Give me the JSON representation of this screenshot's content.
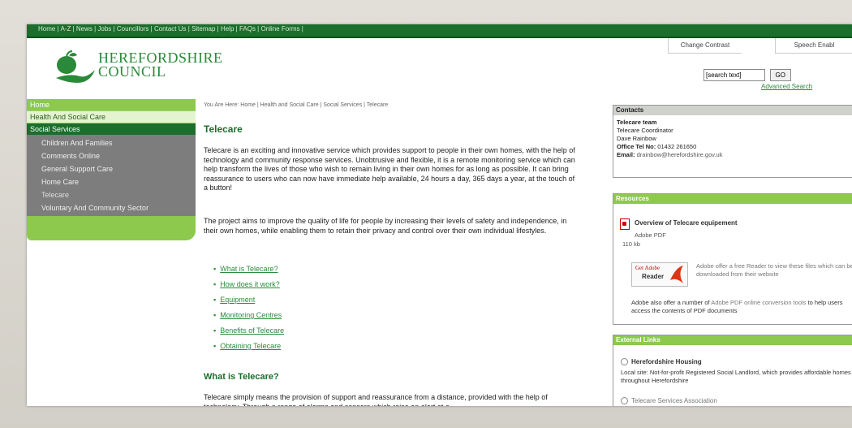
{
  "top_links": [
    "Home",
    "A-Z",
    "News",
    "Jobs",
    "Councillors",
    "Contact Us",
    "Sitemap",
    "Help",
    "FAQs",
    "Online Forms"
  ],
  "utility": {
    "contrast": "Change Contrast",
    "speech": "Speech Enabl"
  },
  "logo": {
    "line1": "HEREFORDSHIRE",
    "line2": "COUNCIL"
  },
  "search": {
    "placeholder": "[search text]",
    "go": "GO",
    "advanced": "Advanced Search"
  },
  "nav": {
    "home": "Home",
    "health": "Health And Social Care",
    "social": "Social Services",
    "items": [
      "Children And Families",
      "Comments Online",
      "General Support Care",
      "Home Care",
      "Telecare",
      "Voluntary And Community Sector"
    ]
  },
  "breadcrumb": "You Are Here: Home | Health and Social Care | Social Services | Telecare",
  "main": {
    "title": "Telecare",
    "para1": "Telecare is an exciting and innovative service which provides support to people in their own homes, with the help of technology and community response services. Unobtrusive and flexible, it is a remote monitoring service which can help transform the lives of those who wish to remain living in their own homes for as long as possible. It can bring reassurance to users who can now have immediate help available, 24 hours a day, 365 days a year, at the touch of a button!",
    "para2": "The project aims to improve the quality of life for people by increasing their levels of safety and independence, in their own homes, while enabling them to retain their privacy and control over their own individual lifestyles.",
    "toc": [
      "What is Telecare?",
      "How does it work?",
      "Equipment",
      "Monitoring Centres",
      "Benefits of Telecare",
      "Obtaining Telecare"
    ],
    "subtitle": "What is Telecare?",
    "para3": "Telecare simply means the provision of support and reassurance from a distance, provided with the help of technology. Through a range of alarms and sensors which raise an alert at a"
  },
  "contacts": {
    "header": "Contacts",
    "team": "Telecare team",
    "role": "Telecare Coordinator",
    "name": "Dave Rainbow",
    "tel_label": "Office Tel No:",
    "tel": "01432 261650",
    "email_label": "Email:",
    "email": "drainbow@herefordshire.gov.uk"
  },
  "resources": {
    "header": "Resources",
    "doc_title": "Overview of Telecare equipement",
    "doc_type": "Adobe PDF",
    "doc_size": "110 kb",
    "adobe_get": "Get Adobe",
    "adobe_reader": "Reader",
    "adobe_text": "Adobe offer a free Reader to view these files which can be downloaded from their website",
    "note_pre": "Adobe also offer a number of ",
    "note_link": "Adobe PDF online conversion tools",
    "note_post": " to help users access the contents of PDF documents"
  },
  "external": {
    "header": "External Links",
    "link1": "Herefordshire Housing",
    "link1_desc": "Local site: Not-for-profit Registered Social Landlord, which provides affordable homes throughout Herefordshire",
    "link2": "Telecare Services Association"
  },
  "colors": {
    "brand_dark": "#1b6e2c",
    "brand_light": "#8cc94d",
    "nav_grey": "#7d7d7d"
  }
}
